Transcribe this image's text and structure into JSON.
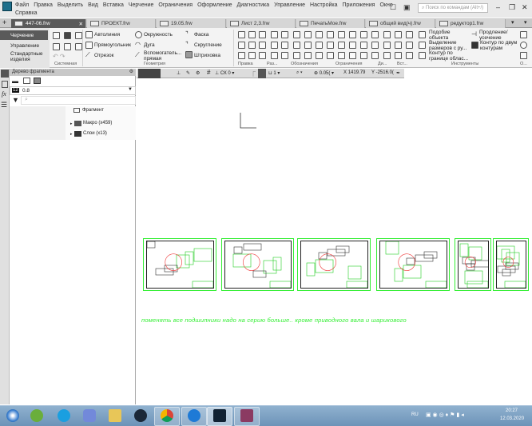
{
  "menu": [
    "Файл",
    "Правка",
    "Выделить",
    "Вид",
    "Вставка",
    "Черчение",
    "Ограничения",
    "Оформление",
    "Диагностика",
    "Управление",
    "Настройка",
    "Приложения",
    "Окно"
  ],
  "menu_help": "Справка",
  "search_placeholder": "Поиск по командам (Alt+/)",
  "tabs": [
    "447-06.frw",
    "ПРОЕКТ.frw",
    "19.05.frw",
    "Лист 2,3.frw",
    "ПечатьМое.frw",
    "общий вид(ч).frw",
    "редуктор1.frw"
  ],
  "modes": [
    "Черчение",
    "Управление",
    "Стандартные изделия"
  ],
  "ribbon": {
    "geometry": [
      "Автолиния",
      "Окружность",
      "Фаска",
      "Прямоугольник",
      "Дуга",
      "Скругление",
      "Отрезок",
      "Вспомогатель... прямая",
      "Штриховка"
    ],
    "tools": [
      "Подобие объекта",
      "Выделение размеров с ру...",
      "Контур по границе облас...",
      "Продление/ усечение",
      "Контур по двум контурам"
    ],
    "groups": [
      "Системная",
      "Геометрия",
      "Правка",
      "Раз...",
      "Обозначения",
      "Ограничения",
      "Ди...",
      "Вст...",
      "Инструменты",
      "О..."
    ]
  },
  "panel": {
    "title": "Дерево фрагмента",
    "layer_num": "12",
    "layer_value": "0.8",
    "tree_root": "Фрагмент",
    "tree_items": [
      "Макро (x459)",
      "Слои (x13)"
    ]
  },
  "canvas_toolbar": {
    "cs": "СК 0",
    "style": "1",
    "zoom": "0.05(",
    "x_label": "X",
    "x": "1419.79",
    "y_label": "Y",
    "y": "-2516.0("
  },
  "note": "поменять все подшипники надо на серию больше.. кроме приводного вала и шарикового",
  "tray": {
    "lang": "RU",
    "time": "20:27",
    "date": "12.03.2020"
  }
}
